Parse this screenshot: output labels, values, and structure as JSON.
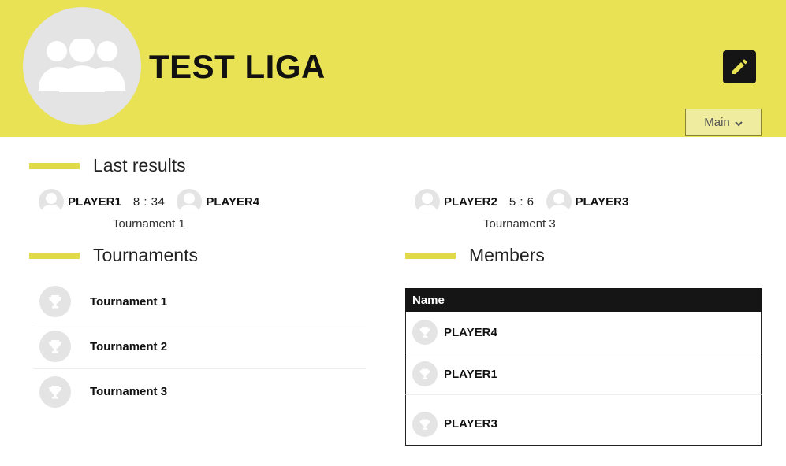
{
  "league": {
    "title": "TEST LIGA",
    "avatar_icon": "group-icon",
    "edit_icon": "pencil-icon",
    "dropdown_label": "Main",
    "dropdown_icon": "chevron-down-icon",
    "accent_color": "#e8e254"
  },
  "sections": {
    "last_results": "Last results",
    "tournaments": "Tournaments",
    "members": "Members"
  },
  "results": [
    {
      "player1": "PLAYER1",
      "score": "8 : 34",
      "player2": "PLAYER4",
      "tournament": "Tournament 1"
    },
    {
      "player1": "PLAYER2",
      "score": "5 : 6",
      "player2": "PLAYER3",
      "tournament": "Tournament 3"
    }
  ],
  "tournaments": [
    {
      "name": "Tournament 1",
      "icon": "trophy-icon"
    },
    {
      "name": "Tournament 2",
      "icon": "trophy-icon"
    },
    {
      "name": "Tournament 3",
      "icon": "trophy-icon"
    }
  ],
  "members_table": {
    "header": "Name",
    "rows": [
      {
        "name": "PLAYER4",
        "icon": "trophy-icon"
      },
      {
        "name": "PLAYER1",
        "icon": "trophy-icon"
      },
      {
        "name": "PLAYER3",
        "icon": "trophy-icon"
      }
    ]
  }
}
